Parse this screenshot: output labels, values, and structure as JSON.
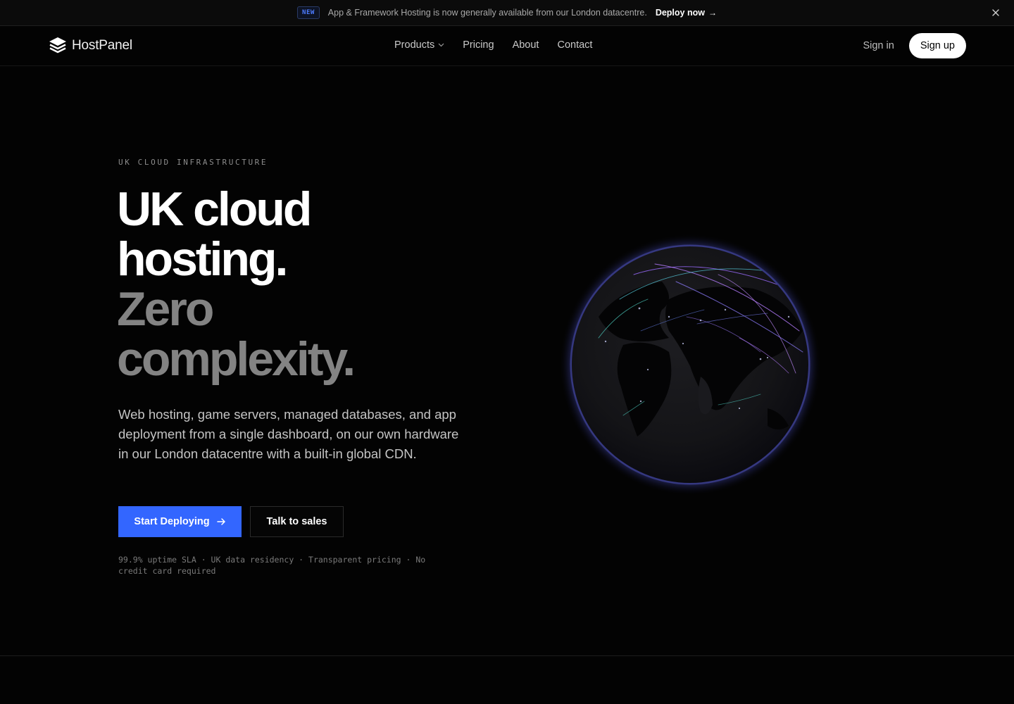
{
  "announcement": {
    "badge": "NEW",
    "text": "App & Framework Hosting is now generally available from our London datacentre.",
    "link": "Deploy now",
    "link_arrow": "→",
    "close_icon": "close-icon"
  },
  "nav": {
    "brand": "HostPanel",
    "links": [
      {
        "label": "Products",
        "has_dropdown": true
      },
      {
        "label": "Pricing"
      },
      {
        "label": "About"
      },
      {
        "label": "Contact"
      }
    ],
    "sign_in": "Sign in",
    "sign_up": "Sign up"
  },
  "hero": {
    "eyebrow": "UK CLOUD INFRASTRUCTURE",
    "headline": [
      "UK cloud",
      "hosting.",
      "Zero",
      "complexity."
    ],
    "subtitle": "Web hosting, game servers, managed databases, and app deployment from a single dashboard, on our own hardware in our London datacentre with a built-in global CDN.",
    "primary_cta": "Start Deploying",
    "primary_cta_arrow": "→",
    "secondary_cta": "Talk to sales",
    "fineprint": "99.9% uptime SLA · UK data residency · Transparent pricing · No credit card required"
  },
  "colors": {
    "background": "#030303",
    "accent": "#3366ff",
    "muted_heading": "#838383"
  }
}
